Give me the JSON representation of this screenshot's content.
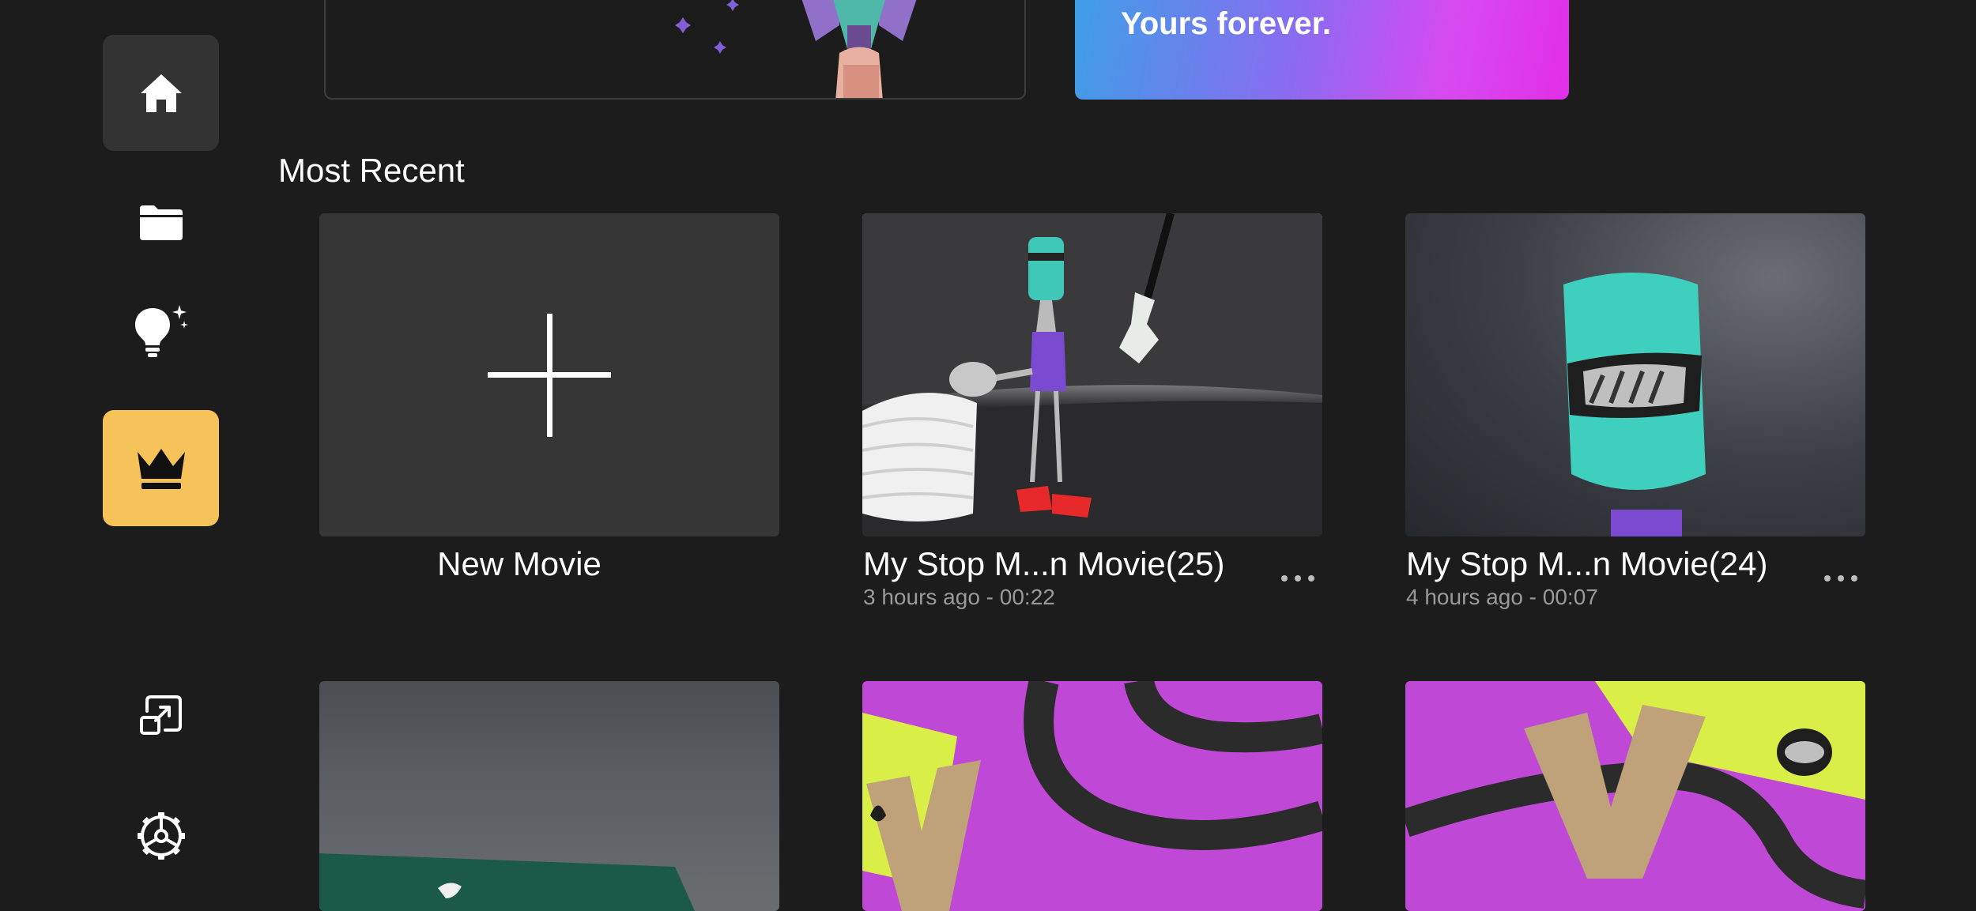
{
  "sidebar": {
    "items": [
      {
        "id": "home",
        "icon": "home-icon"
      },
      {
        "id": "projects",
        "icon": "folder-icon"
      },
      {
        "id": "ideas",
        "icon": "lightbulb-sparkle-icon"
      },
      {
        "id": "premium",
        "icon": "crown-icon"
      },
      {
        "id": "external-display",
        "icon": "external-display-icon"
      },
      {
        "id": "settings",
        "icon": "gear-icon"
      }
    ]
  },
  "banners": {
    "promo_text": "Yours forever."
  },
  "section": {
    "title": "Most Recent"
  },
  "new_movie": {
    "label": "New Movie"
  },
  "movies": [
    {
      "title": "My Stop M...n Movie(25)",
      "meta": "3 hours ago - 00:22",
      "more": "..."
    },
    {
      "title": "My Stop M...n Movie(24)",
      "meta": "4 hours ago - 00:07",
      "more": "..."
    }
  ],
  "colors": {
    "background": "#1c1c1c",
    "sidebar_selected": "#333333",
    "premium_accent": "#f5c35a",
    "meta_text": "#9a9a9a"
  }
}
